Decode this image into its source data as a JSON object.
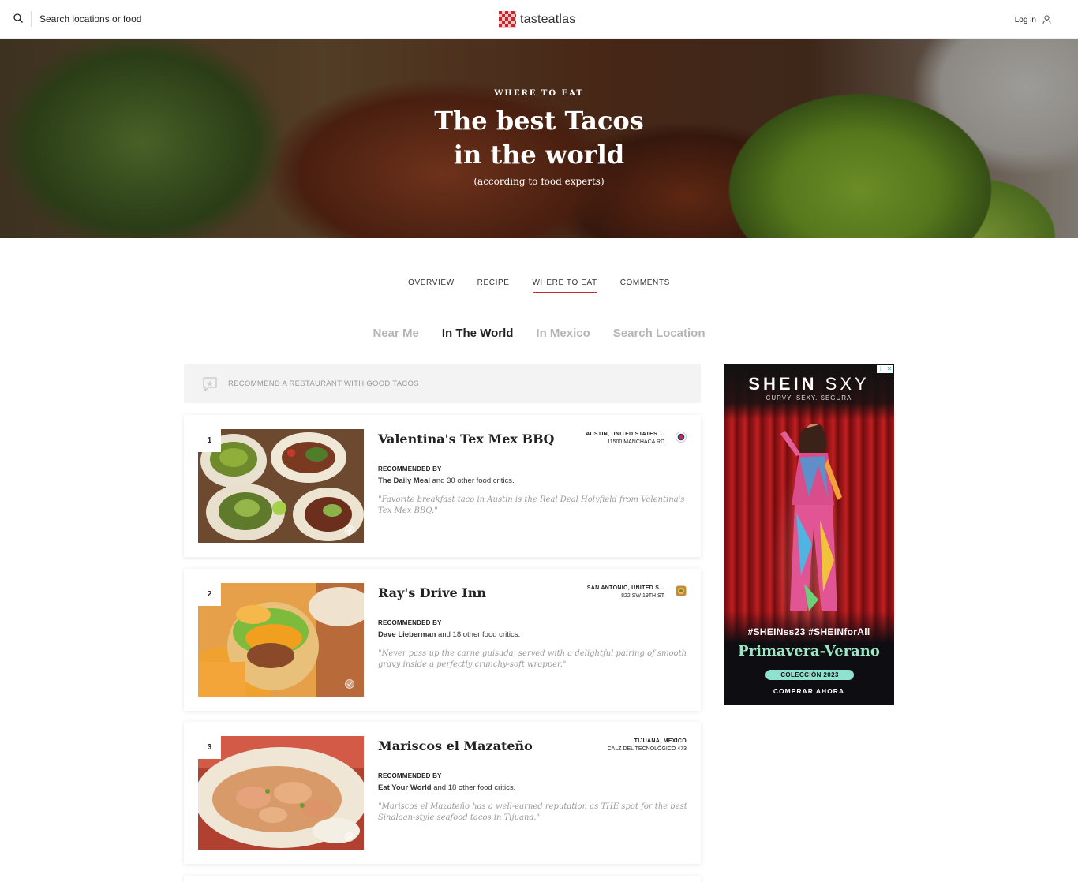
{
  "header": {
    "search_placeholder": "Search locations or food",
    "logo_text": "tasteatlas",
    "login_label": "Log in"
  },
  "hero": {
    "kicker": "WHERE TO EAT",
    "title_line1": "The best Tacos",
    "title_line2": "in the world",
    "subtitle": "(according to food experts)"
  },
  "tabs": [
    {
      "label": "OVERVIEW",
      "active": false
    },
    {
      "label": "RECIPE",
      "active": false
    },
    {
      "label": "WHERE TO EAT",
      "active": true
    },
    {
      "label": "COMMENTS",
      "active": false
    }
  ],
  "subtabs": [
    {
      "label": "Near Me",
      "active": false
    },
    {
      "label": "In The World",
      "active": true
    },
    {
      "label": "In Mexico",
      "active": false
    },
    {
      "label": "Search Location",
      "active": false
    }
  ],
  "recommend": {
    "label": "RECOMMEND A RESTAURANT WITH GOOD TACOS"
  },
  "restaurants": [
    {
      "rank": "1",
      "name": "Valentina's Tex Mex BBQ",
      "city": "AUSTIN, UNITED STATES ...",
      "address": "11500 MANCHACA RD",
      "recommended_label": "RECOMMENDED BY",
      "critic": "The Daily Meal",
      "others": "and 30 other food critics.",
      "quote": "\"Favorite breakfast taco in Austin is the Real Deal Holyfield from Valentina's Tex Mex BBQ.\"",
      "badge_icon": "award-seal-icon"
    },
    {
      "rank": "2",
      "name": "Ray's Drive Inn",
      "city": "SAN ANTONIO, UNITED S...",
      "address": "822 SW 19TH ST",
      "recommended_label": "RECOMMENDED BY",
      "critic": "Dave Lieberman",
      "others": "and 18 other food critics.",
      "quote": "\"Never pass up the carne guisada, served with a delightful pairing of smooth gravy inside a perfectly crunchy-soft wrapper.\"",
      "badge_icon": "food-badge-icon"
    },
    {
      "rank": "3",
      "name": "Mariscos el Mazateño",
      "city": "TIJUANA, MEXICO",
      "address": "CALZ DEL TECNOLÓGICO 473",
      "recommended_label": "RECOMMENDED BY",
      "critic": "Eat Your World",
      "others": "and 18 other food critics.",
      "quote": "\"Mariscos el Mazateño has a well-earned reputation as THE spot for the best Sinaloan-style seafood tacos in Tijuana.\""
    }
  ],
  "ad": {
    "brand_bold": "SHEIN",
    "brand_light": "SXY",
    "tagline": "CURVY. SEXY. SEGURA",
    "hashtags": "#SHEINss23  #SHEINforAll",
    "season": "Primavera-Verano",
    "collection": "COLECCIÓN 2023",
    "cta": "COMPRAR AHORA"
  }
}
